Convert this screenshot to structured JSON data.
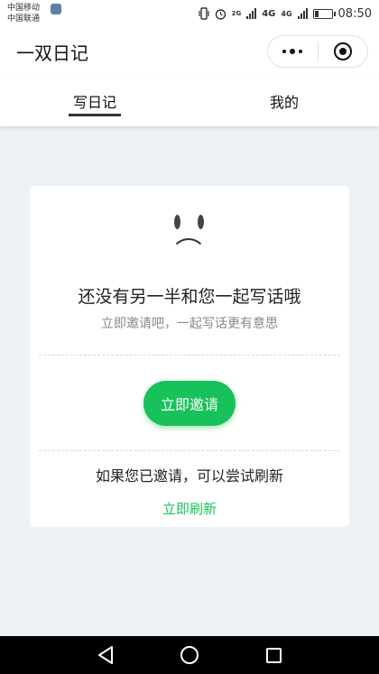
{
  "status_bar": {
    "carrier_1": "中国移动",
    "carrier_2": "中国联通",
    "net_1": "2G",
    "net_2": "4G",
    "net_3": "4G",
    "time": "08:50",
    "battery_level": 0.25
  },
  "header": {
    "title": "一双日记"
  },
  "tabs": [
    {
      "label": "写日记",
      "active": true
    },
    {
      "label": "我的",
      "active": false
    }
  ],
  "empty_state": {
    "headline": "还没有另一半和您一起写话哦",
    "subline": "立即邀请吧，一起写话更有意思",
    "invite_button": "立即邀请",
    "refresh_hint": "如果您已邀请，可以尝试刷新",
    "refresh_link": "立即刷新"
  },
  "colors": {
    "accent": "#19c15a",
    "background": "#eef1f4"
  },
  "icons": {
    "more": "more-dots-icon",
    "close": "target-circle-icon",
    "face": "sad-face-icon",
    "nav_back": "triangle-back-icon",
    "nav_home": "circle-home-icon",
    "nav_recent": "square-recent-icon"
  }
}
